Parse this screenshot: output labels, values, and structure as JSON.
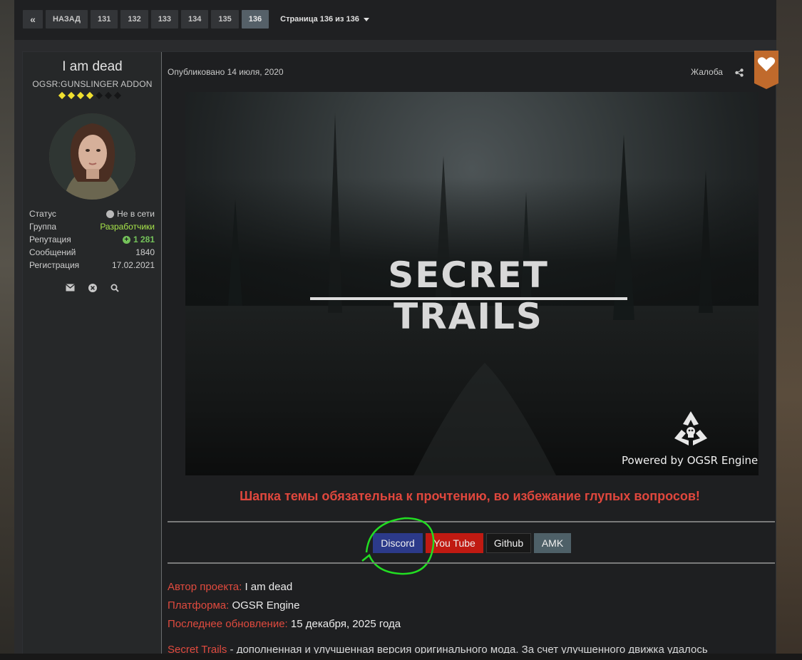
{
  "pagination": {
    "first_icon": "«",
    "back_label": "НАЗАД",
    "pages": [
      "131",
      "132",
      "133",
      "134",
      "135",
      "136"
    ],
    "active_page": "136",
    "page_info": "Страница 136 из 136"
  },
  "author": {
    "name": "I am dead",
    "title": "OGSR:GUNSLINGER ADDON",
    "rank_pips_filled": 4,
    "rank_pips_total": 7,
    "stats": {
      "status_label": "Статус",
      "status_value": "Не в сети",
      "group_label": "Группа",
      "group_value": "Разработчики",
      "rep_label": "Репутация",
      "rep_value": "1 281",
      "posts_label": "Сообщений",
      "posts_value": "1840",
      "reg_label": "Регистрация",
      "reg_value": "17.02.2021"
    },
    "actions": [
      "envelope-icon",
      "close-circle-icon",
      "search-icon"
    ]
  },
  "post": {
    "posted": "Опубликовано 14 июля, 2020",
    "complain": "Жалоба",
    "banner_title": "SECRET TRAILS",
    "banner_powered": "Powered by OGSR Engine",
    "notice": "Шапка темы обязательна к прочтению, во избежание глупых вопросов!",
    "links": {
      "discord": "Discord",
      "youtube": "You Tube",
      "github": "Github",
      "amk": "AMK"
    },
    "info": {
      "author_key": "Автор проекта:",
      "author_val": "I am dead",
      "platform_key": "Платформа:",
      "platform_val": "OGSR Engine",
      "update_key": "Последнее обновление:",
      "update_val": "15 декабря, 2025 года"
    },
    "desc_key": "Secret Trails",
    "desc_text": " - дополненная и улучшенная версия оригинального мода. За счет улучшенного движка удалось"
  },
  "colors": {
    "accent_red": "#e0473d",
    "like_badge": "#c06a2c",
    "discord": "#2c3a8a",
    "youtube": "#c01a12",
    "amk": "#4e6068",
    "rank_pip": "#f0e030",
    "group_green": "#a7e44a",
    "annotation_green": "#22dd22"
  }
}
